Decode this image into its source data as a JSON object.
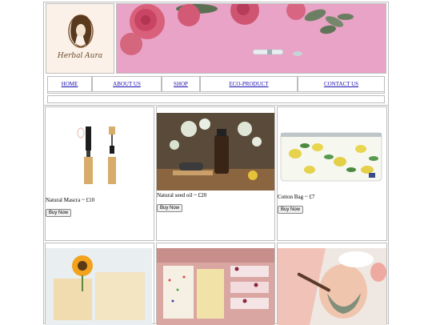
{
  "brand": {
    "logo_text": "Herbal Aura"
  },
  "nav": {
    "items": [
      "HOME",
      "ABOUT US",
      "SHOP",
      "ECO-PRODUCT",
      "CONTACT US"
    ]
  },
  "products": [
    {
      "name": "Natural Mascra ~ £10",
      "button": "Buy Now"
    },
    {
      "name": "Natural seed oil ~ £20",
      "button": "Buy Now"
    },
    {
      "name": "Cotton Bag ~ £7",
      "button": "Buy Now"
    }
  ],
  "colors": {
    "link": "#1a0dab",
    "banner": "#e9a6c8",
    "border": "#bdbdbd"
  }
}
